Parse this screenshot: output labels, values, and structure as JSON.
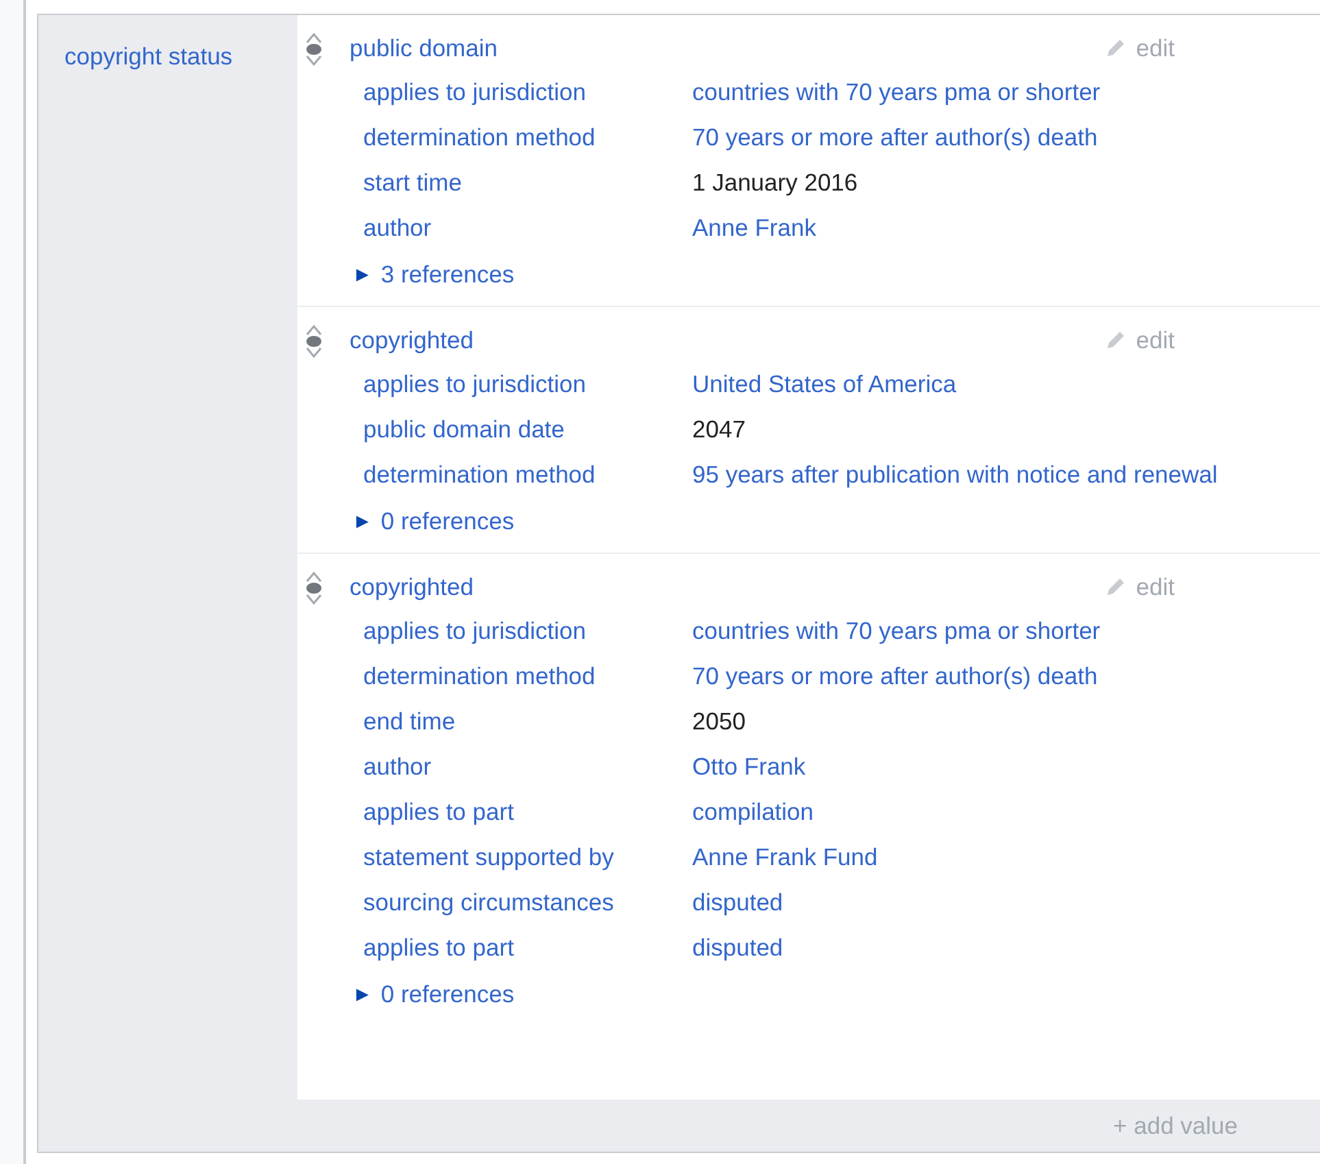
{
  "property": {
    "label": "copyright status"
  },
  "statements": [
    {
      "value": {
        "text": "public domain",
        "kind": "link"
      },
      "edit": "edit",
      "qualifiers": [
        {
          "label": "applies to jurisdiction",
          "value": "countries with 70 years pma or shorter",
          "kind": "link"
        },
        {
          "label": "determination method",
          "value": "70 years or more after author(s) death",
          "kind": "link"
        },
        {
          "label": "start time",
          "value": "1 January 2016",
          "kind": "text"
        },
        {
          "label": "author",
          "value": "Anne Frank",
          "kind": "link"
        }
      ],
      "references": {
        "label": "3 references",
        "expanded": false,
        "toggle": "►"
      }
    },
    {
      "value": {
        "text": "copyrighted",
        "kind": "link"
      },
      "edit": "edit",
      "qualifiers": [
        {
          "label": "applies to jurisdiction",
          "value": "United States of America",
          "kind": "link"
        },
        {
          "label": "public domain date",
          "value": "2047",
          "kind": "text"
        },
        {
          "label": "determination method",
          "value": "95 years after publication with notice and renewal",
          "kind": "link"
        }
      ],
      "references": {
        "label": "0 references",
        "expanded": false,
        "toggle": "►"
      }
    },
    {
      "value": {
        "text": "copyrighted",
        "kind": "link"
      },
      "edit": "edit",
      "qualifiers": [
        {
          "label": "applies to jurisdiction",
          "value": "countries with 70 years pma or shorter",
          "kind": "link"
        },
        {
          "label": "determination method",
          "value": "70 years or more after author(s) death",
          "kind": "link"
        },
        {
          "label": "end time",
          "value": "2050",
          "kind": "text"
        },
        {
          "label": "author",
          "value": "Otto Frank",
          "kind": "link"
        },
        {
          "label": "applies to part",
          "value": "compilation",
          "kind": "link"
        },
        {
          "label": "statement supported by",
          "value": "Anne Frank Fund",
          "kind": "link"
        },
        {
          "label": "sourcing circumstances",
          "value": "disputed",
          "kind": "link"
        },
        {
          "label": "applies to part",
          "value": "disputed",
          "kind": "link"
        }
      ],
      "references": {
        "label": "0 references",
        "expanded": false,
        "toggle": "►"
      }
    }
  ],
  "add_value": "+ add value"
}
